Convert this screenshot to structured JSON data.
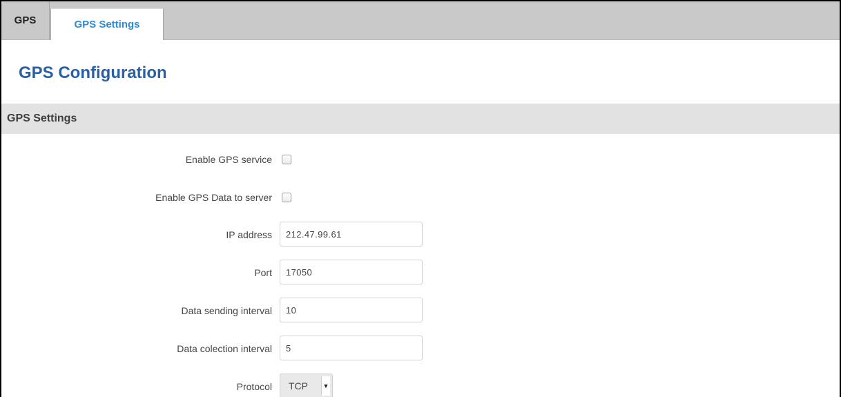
{
  "tabs": [
    {
      "label": "GPS"
    },
    {
      "label": "GPS Settings"
    }
  ],
  "page_title": "GPS Configuration",
  "section_title": "GPS Settings",
  "fields": {
    "enable_gps_service": {
      "label": "Enable GPS service",
      "checked": false
    },
    "enable_gps_data_to_server": {
      "label": "Enable GPS Data to server",
      "checked": false
    },
    "ip_address": {
      "label": "IP address",
      "value": "212.47.99.61"
    },
    "port": {
      "label": "Port",
      "value": "17050"
    },
    "data_sending_interval": {
      "label": "Data sending interval",
      "value": "10"
    },
    "data_collection_interval": {
      "label": "Data colection interval",
      "value": "5"
    },
    "protocol": {
      "label": "Protocol",
      "value": "TCP"
    }
  },
  "icons": {
    "dropdown": "chevron-down-icon"
  },
  "colors": {
    "active_tab": "#2f8bd3",
    "title": "#2a5fa3",
    "section_bg": "#e2e2e2",
    "tabbar_bg": "#c9c9c9"
  }
}
